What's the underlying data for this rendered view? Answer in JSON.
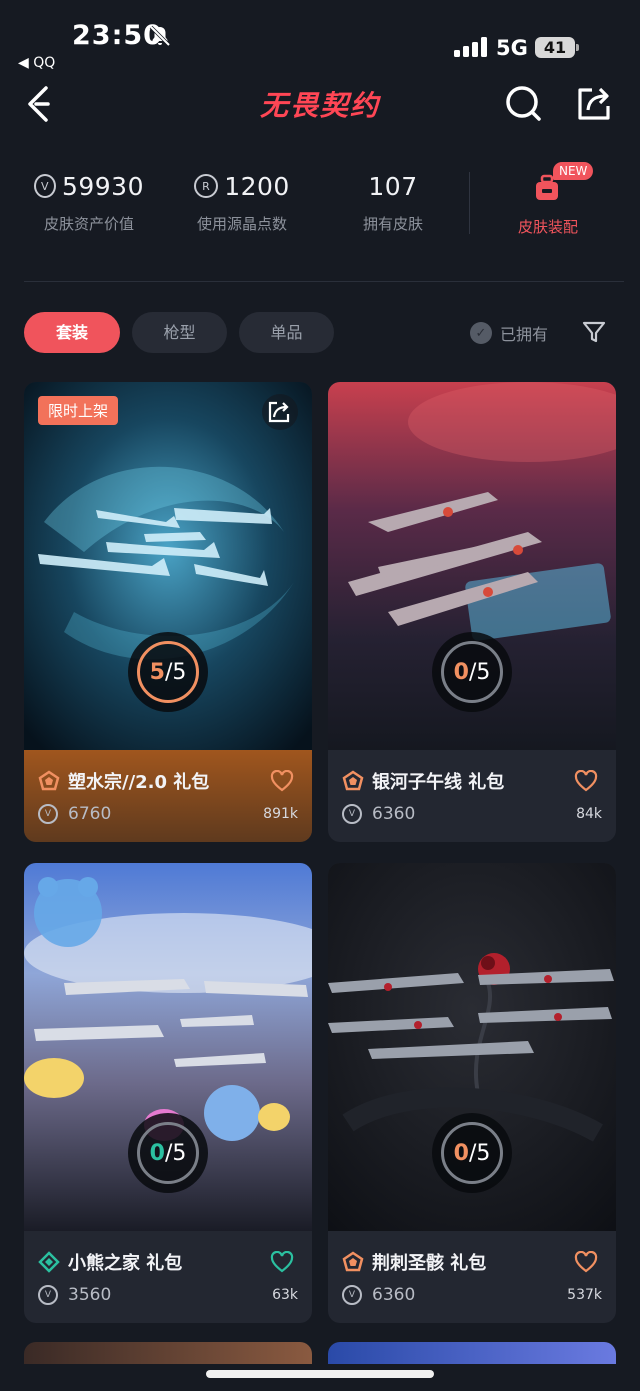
{
  "status_bar": {
    "time": "23:50",
    "back_app": "◀ QQ",
    "network": "5G",
    "battery": "41"
  },
  "nav": {
    "title": "无畏契约"
  },
  "stats": {
    "asset_value": "59930",
    "asset_label": "皮肤资产价值",
    "radianite": "1200",
    "radianite_label": "使用源晶点数",
    "owned_skins": "107",
    "owned_label": "拥有皮肤",
    "equip_label": "皮肤装配",
    "new_badge": "NEW"
  },
  "tabs": [
    {
      "label": "套装",
      "active": true
    },
    {
      "label": "枪型",
      "active": false
    },
    {
      "label": "单品",
      "active": false
    }
  ],
  "owned_filter_label": "已拥有",
  "cards": [
    {
      "name": "塑水宗//2.0 礼包",
      "price": "6760",
      "likes": "891k",
      "owned": "5",
      "total": "/5",
      "badge": "限时上架",
      "tier_color": "#f19061",
      "heart_color": "#f19061",
      "ring_color": "#f19061"
    },
    {
      "name": "银河子午线 礼包",
      "price": "6360",
      "likes": "84k",
      "owned": "0",
      "total": "/5",
      "tier_color": "#f19061",
      "heart_color": "#f19061",
      "ring_color": "#f19061"
    },
    {
      "name": "小熊之家 礼包",
      "price": "3560",
      "likes": "63k",
      "owned": "0",
      "total": "/5",
      "tier_color": "#2bc0a0",
      "heart_color": "#2bc0a0",
      "ring_color": "#2bc0a0"
    },
    {
      "name": "荆刺圣骸 礼包",
      "price": "6360",
      "likes": "537k",
      "owned": "0",
      "total": "/5",
      "tier_color": "#f19061",
      "heart_color": "#f19061",
      "ring_color": "#f19061"
    }
  ]
}
